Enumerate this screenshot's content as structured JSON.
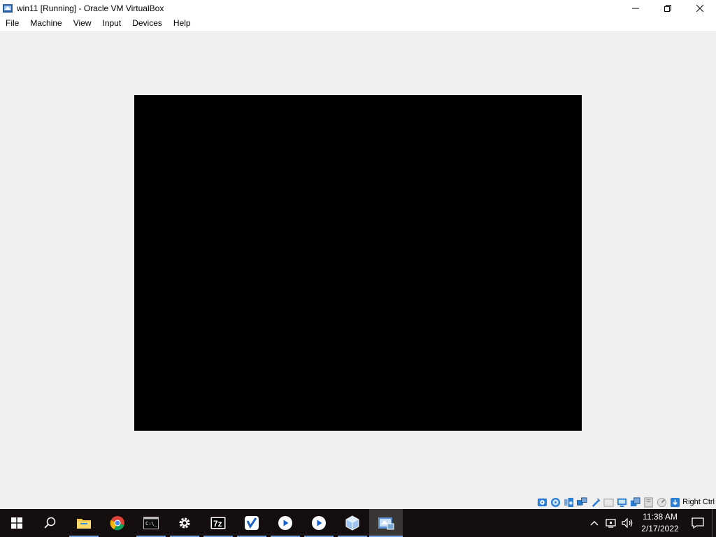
{
  "window": {
    "title": "win11 [Running] - Oracle VM VirtualBox"
  },
  "menu": [
    "File",
    "Machine",
    "View",
    "Input",
    "Devices",
    "Help"
  ],
  "statusbar": {
    "host_key": "Right Ctrl",
    "icons": [
      "hard-disk-icon",
      "optical-drive-icon",
      "audio-icon",
      "network-icon",
      "usb-icon",
      "shared-folders-icon",
      "display-icon",
      "video-capture-icon",
      "vm-state-icon",
      "cpu-icon",
      "mouse-integration-icon",
      "keyboard-icon"
    ]
  },
  "taskbar": {
    "apps": [
      "start-icon",
      "search-icon",
      "file-explorer-icon",
      "chrome-icon",
      "terminal-icon",
      "settings-icon",
      "7zip-icon",
      "app-blue-icon",
      "media-player-icon",
      "media-player-2-icon",
      "virtualbox-icon",
      "virtualbox-vm-icon"
    ]
  },
  "clock": {
    "time": "11:38 AM",
    "date": "2/17/2022"
  }
}
